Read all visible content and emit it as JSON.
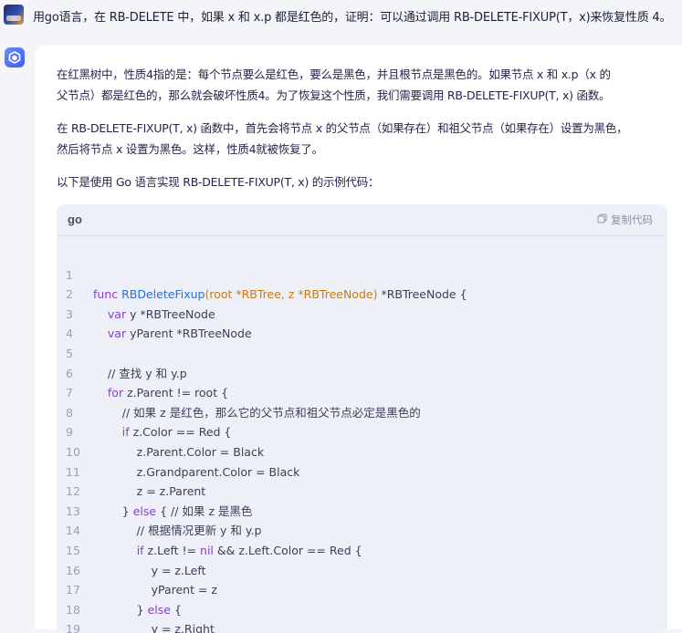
{
  "user": {
    "question": "用go语言，在 RB-DELETE 中，如果 x 和 x.p 都是红色的，证明：可以通过调用 RB-DELETE-FIXUP(T，x)来恢复性质 4。"
  },
  "answer": {
    "para1_line1": "在红黑树中，性质4指的是：每个节点要么是红色，要么是黑色，并且根节点是黑色的。如果节点 x 和 x.p（x 的",
    "para1_line2": "父节点）都是红色的，那么就会破坏性质4。为了恢复这个性质，我们需要调用 RB-DELETE-FIXUP(T, x) 函数。",
    "para2_line1": "在 RB-DELETE-FIXUP(T, x) 函数中，首先会将节点 x 的父节点（如果存在）和祖父节点（如果存在）设置为黑色，",
    "para2_line2": "然后将节点 x 设置为黑色。这样，性质4就被恢复了。",
    "para3": "以下是使用 Go 语言实现 RB-DELETE-FIXUP(T, x) 的示例代码："
  },
  "code": {
    "language": "go",
    "copy_label": "复制代码",
    "line_numbers": [
      "1",
      "2",
      "3",
      "4",
      "5",
      "6",
      "7",
      "8",
      "9",
      "10",
      "11",
      "12",
      "13",
      "14",
      "15",
      "16",
      "17",
      "18",
      "19"
    ]
  },
  "icons": {
    "copy": "copy-icon",
    "bot": "bot-logo-icon",
    "user": "user-avatar"
  }
}
